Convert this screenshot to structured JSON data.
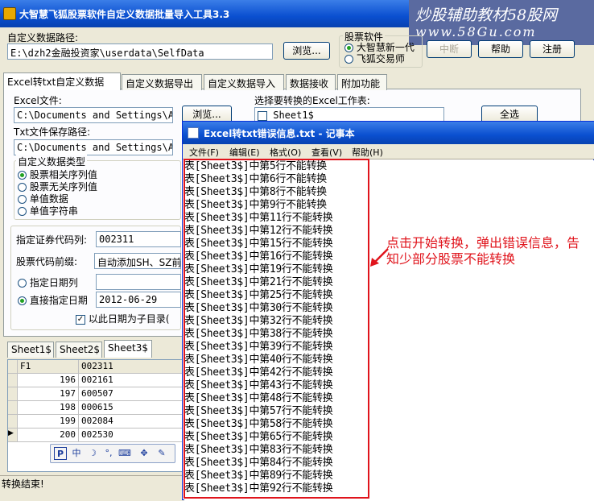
{
  "app": {
    "title": "大智慧飞狐股票软件自定义数据批量导入工具3.3",
    "watermark_line1": "炒股辅助教材58股网",
    "watermark_line2": "www.58Gu.com"
  },
  "top": {
    "path_label": "自定义数据路径:",
    "path_value": "E:\\dzh2金融投资家\\userdata\\SelfData",
    "browse_label": "浏览...",
    "software_group_label": "股票软件",
    "software_options": [
      "大智慧新一代",
      "飞狐交易师"
    ],
    "software_selected": 0,
    "action_buttons": [
      "中断",
      "帮助",
      "注册"
    ]
  },
  "tabs": [
    "Excel转txt自定义数据",
    "自定义数据导出",
    "自定义数据导入",
    "数据接收",
    "附加功能"
  ],
  "form": {
    "excel_label": "Excel文件:",
    "excel_value": "C:\\Documents and Settings\\Ac",
    "excel_browse": "浏览...",
    "txt_label": "Txt文件保存路径:",
    "txt_value": "C:\\Documents and Settings\\Ac",
    "type_group_label": "自定义数据类型",
    "type_options": [
      "股票相关序列值",
      "股票无关序列值",
      "单值数据",
      "单值字符串"
    ],
    "type_selected": 0,
    "code_column_label": "指定证券代码列:",
    "code_column_value": "002311",
    "code_prefix_label": "股票代码前缀:",
    "code_prefix_value": "自动添加SH、SZ前",
    "date_column_label": "指定日期列",
    "direct_date_label": "直接指定日期",
    "direct_date_value": "2012-06-29",
    "date_mode_selected": 1,
    "subdir_label": "以此日期为子目录(",
    "subdir_checked": true,
    "worksheet_label": "选择要转换的Excel工作表:",
    "worksheets": [
      "Sheet1$"
    ],
    "select_all_label": "全选"
  },
  "sheet_tabs": [
    "Sheet1$",
    "Sheet2$",
    "Sheet3$"
  ],
  "sheet_active": 2,
  "grid": {
    "headers": [
      "F1",
      "002311"
    ],
    "rows": [
      {
        "n": "196",
        "code": "002161"
      },
      {
        "n": "197",
        "code": "600507"
      },
      {
        "n": "198",
        "code": "000615"
      },
      {
        "n": "199",
        "code": "002084"
      },
      {
        "n": "200",
        "code": "002530"
      }
    ]
  },
  "status": "转换结束!",
  "notepad": {
    "title": "Excel转txt错误信息.txt - 记事本",
    "menu": [
      "文件(F)",
      "编辑(E)",
      "格式(O)",
      "查看(V)",
      "帮助(H)"
    ],
    "lines": [
      "表[Sheet3$]中第5行不能转换",
      "表[Sheet3$]中第6行不能转换",
      "表[Sheet3$]中第8行不能转换",
      "表[Sheet3$]中第9行不能转换",
      "表[Sheet3$]中第11行不能转换",
      "表[Sheet3$]中第12行不能转换",
      "表[Sheet3$]中第15行不能转换",
      "表[Sheet3$]中第16行不能转换",
      "表[Sheet3$]中第19行不能转换",
      "表[Sheet3$]中第21行不能转换",
      "表[Sheet3$]中第25行不能转换",
      "表[Sheet3$]中第30行不能转换",
      "表[Sheet3$]中第32行不能转换",
      "表[Sheet3$]中第38行不能转换",
      "表[Sheet3$]中第39行不能转换",
      "表[Sheet3$]中第40行不能转换",
      "表[Sheet3$]中第42行不能转换",
      "表[Sheet3$]中第43行不能转换",
      "表[Sheet3$]中第48行不能转换",
      "表[Sheet3$]中第57行不能转换",
      "表[Sheet3$]中第58行不能转换",
      "表[Sheet3$]中第65行不能转换",
      "表[Sheet3$]中第83行不能转换",
      "表[Sheet3$]中第84行不能转换",
      "表[Sheet3$]中第89行不能转换",
      "表[Sheet3$]中第92行不能转换"
    ]
  },
  "annotation": "点击开始转换，弹出错误信息，告知少部分股票不能转换",
  "ime_items": [
    "P",
    "中",
    "moon-icon",
    "dots-icon",
    "keyboard-icon",
    "settings-icon",
    "wrench-icon"
  ],
  "colors": {
    "annotation": "#e0141c",
    "titlebar": "#0a4fd0"
  }
}
